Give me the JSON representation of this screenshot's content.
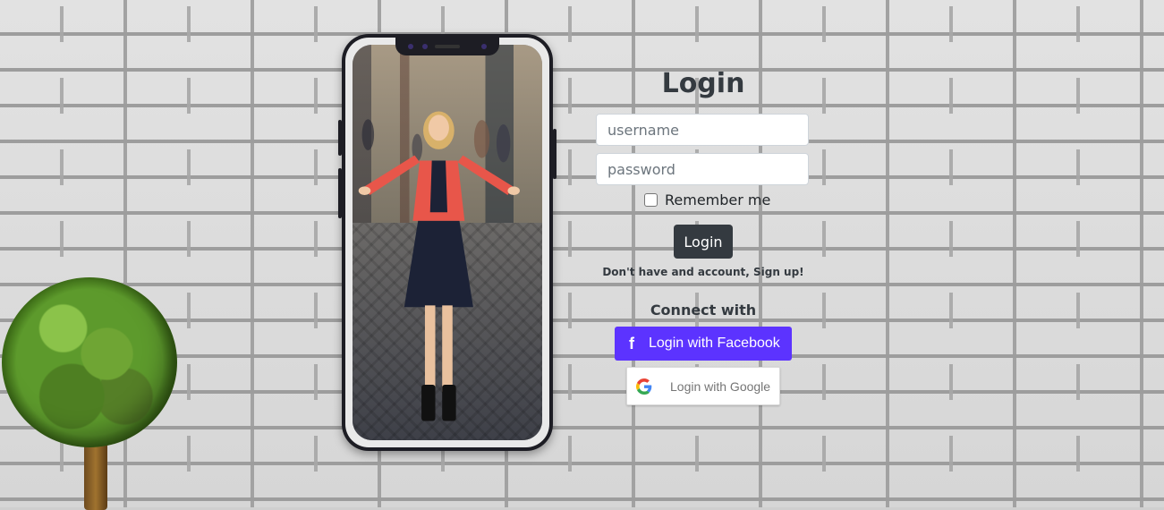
{
  "login": {
    "title": "Login",
    "username_placeholder": "username",
    "password_placeholder": "password",
    "remember_label": "Remember me",
    "submit_label": "Login",
    "signup_text": "Don't have and account, Sign up!",
    "connect_label": "Connect with"
  },
  "social": {
    "facebook_label": "Login with Facebook",
    "facebook_icon": "facebook-icon",
    "google_label": "Login with Google",
    "google_icon": "google-icon"
  },
  "colors": {
    "dark": "#343a40",
    "facebook": "#5c33ff"
  }
}
